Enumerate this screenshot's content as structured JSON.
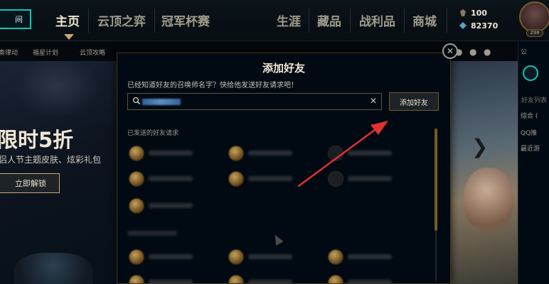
{
  "topbar": {
    "play_label": "间",
    "nav": [
      "主页",
      "云顶之弈",
      "冠军杯赛",
      "生涯",
      "藏品",
      "战利品",
      "商城"
    ],
    "currency": {
      "blue_essence": "100",
      "riot_points": "82370"
    },
    "level": "298"
  },
  "subnav": {
    "items": [
      "奏律动",
      "福星计划",
      "云顶攻略"
    ]
  },
  "promo": {
    "title": "限时5折",
    "subtitle": "侣人节主题皮肤、炫彩礼包",
    "button": "立即解锁"
  },
  "social": {
    "header": "公",
    "list_title": "好友列表",
    "groups": [
      "综合 (",
      "QQ推",
      "最近游"
    ]
  },
  "modal": {
    "title": "添加好友",
    "prompt": "已经知道好友的召唤师名字？快给他发送好友请求吧！",
    "search_value": "",
    "clear_label": "✕",
    "add_button": "添加好友",
    "sent_label": "已发送的好友请求",
    "close_label": "✕"
  },
  "colors": {
    "gold": "#c8aa6e",
    "gold_dark": "#785a28",
    "teal": "#0ac8b9",
    "text": "#f0e6d2",
    "arrow": "#e03030"
  },
  "icons": [
    "search-icon",
    "close-icon",
    "blue-essence-icon",
    "riot-points-icon",
    "chevron-right-icon",
    "chat-icon",
    "mission-icon",
    "mouse-cursor-icon"
  ]
}
